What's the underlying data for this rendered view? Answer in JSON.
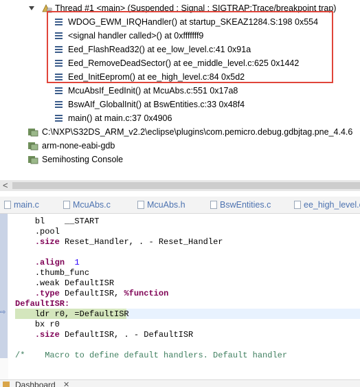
{
  "debug_view": {
    "thread_label": "Thread #1 <main> (Suspended : Signal : SIGTRAP:Trace/breakpoint trap)",
    "frames": [
      "WDOG_EWM_IRQHandler() at startup_SKEAZ1284.S:198 0x554",
      "<signal handler called>() at 0xfffffff9",
      "Eed_FlashRead32() at ee_low_level.c:41 0x91a",
      "Eed_RemoveDeadSector() at ee_middle_level.c:625 0x1442",
      "Eed_InitEeprom() at ee_high_level.c:84 0x5d2",
      "McuAbsIf_EedInit() at McuAbs.c:551 0x17a8",
      "BswAIf_GlobalInit() at BswEntities.c:33 0x48f4",
      "main() at main.c:37 0x4906"
    ],
    "processes": [
      "C:\\NXP\\S32DS_ARM_v2.2\\eclipse\\plugins\\com.pemicro.debug.gdbjtag.pne_4.4.6",
      "arm-none-eabi-gdb",
      "Semihosting Console"
    ]
  },
  "scrollbar": {
    "left_arrow": "<"
  },
  "editor_tabs": [
    "main.c",
    "McuAbs.c",
    "McuAbs.h",
    "BswEntities.c",
    "ee_high_level.c"
  ],
  "code": {
    "l1_op": "bl",
    "l1_arg": "__START",
    "l2": ".pool",
    "l3_dir": ".size",
    "l3_arg": " Reset_Handler, . - Reset_Handler",
    "l5_dir": ".align",
    "l5_num": "1",
    "l6": ".thumb_func",
    "l7": ".weak DefaultISR",
    "l8_dir": ".type",
    "l8_arg": " DefaultISR, ",
    "l8_kw": "%function",
    "l9_label": "DefaultISR:",
    "l10": "ldr r0, =DefaultISR",
    "l11": "bx r0",
    "l12_dir": ".size",
    "l12_arg": " DefaultISR, . - DefaultISR",
    "l14": "/*    Macro to define default handlers. Default handler"
  },
  "bottom": {
    "tab_label": "Dashboard",
    "close": "✕"
  },
  "colors": {
    "highlight_border": "#e0453a",
    "link_blue": "#4c72b0",
    "keyword": "#7f0055"
  }
}
